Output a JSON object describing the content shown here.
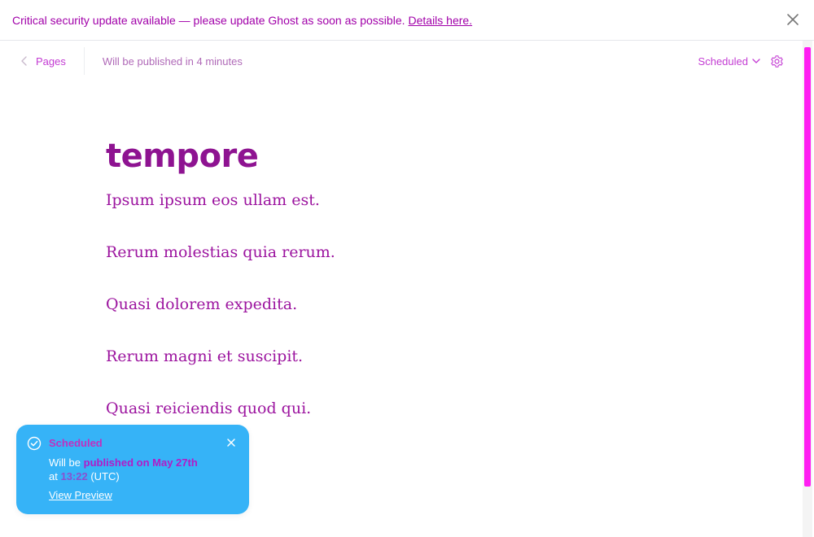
{
  "alert": {
    "message": "Critical security update available — please update Ghost as soon as possible.",
    "link_label": "Details here."
  },
  "toolbar": {
    "back_label": "Pages",
    "publish_status": "Will be published in 4 minutes",
    "status_dropdown_label": "Scheduled"
  },
  "post": {
    "title": "tempore",
    "paragraphs": [
      "Ipsum ipsum eos ullam est.",
      "Rerum molestias quia rerum.",
      "Quasi dolorem expedita.",
      "Rerum magni et suscipit.",
      "Quasi reiciendis quod qui."
    ]
  },
  "toast": {
    "title": "Scheduled",
    "message_prefix": "Will be",
    "message_date": "published on May 27th",
    "message_at": "at",
    "message_time": "13:22",
    "message_tz": "(UTC)",
    "preview_label": "View Preview"
  },
  "colors": {
    "accent": "#c33bd3",
    "toast_bg": "#36b3f7",
    "scrollbar_thumb": "#ff1ef2"
  },
  "icons": {
    "alert_close": "close-icon",
    "back": "chevron-left-icon",
    "dropdown": "chevron-down-icon",
    "settings": "gear-icon",
    "toast_status": "check-circle-icon",
    "toast_close": "close-icon"
  }
}
